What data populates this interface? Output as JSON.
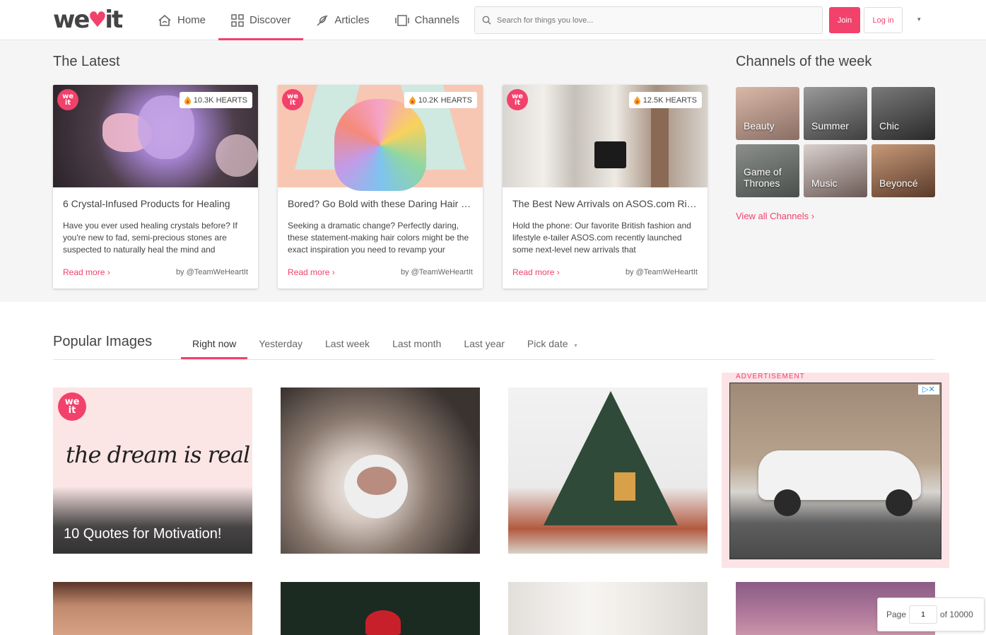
{
  "header": {
    "nav": [
      {
        "label": "Home",
        "icon": "home-icon"
      },
      {
        "label": "Discover",
        "icon": "grid-icon"
      },
      {
        "label": "Articles",
        "icon": "feather-icon"
      },
      {
        "label": "Channels",
        "icon": "channels-icon"
      }
    ],
    "search_placeholder": "Search for things you love...",
    "join_label": "Join",
    "login_label": "Log in",
    "menu_caret": "▾"
  },
  "latest": {
    "title": "The Latest",
    "cards": [
      {
        "hearts": "10.3K HEARTS",
        "title": "6 Crystal-Infused Products for Healing",
        "text": "Have you ever used healing crystals before? If you're new to fad, semi-precious stones are suspected to naturally heal the mind and",
        "read_more": "Read more ›",
        "author": "by @TeamWeHeartIt"
      },
      {
        "hearts": "10.2K HEARTS",
        "title": "Bored? Go Bold with these Daring Hair Colors",
        "text": "Seeking a dramatic change? Perfectly daring, these statement-making hair colors might be the exact inspiration you need to revamp your",
        "read_more": "Read more ›",
        "author": "by @TeamWeHeartIt"
      },
      {
        "hearts": "12.5K HEARTS",
        "title": "The Best New Arrivals on ASOS.com Right Now",
        "text": "Hold the phone: Our favorite British fashion and lifestyle e-tailer ASOS.com recently launched some next-level new arrivals that",
        "read_more": "Read more ›",
        "author": "by @TeamWeHeartIt"
      }
    ]
  },
  "channels": {
    "title": "Channels of the week",
    "items": [
      "Beauty",
      "Summer",
      "Chic",
      "Game of Thrones",
      "Music",
      "Beyoncé"
    ],
    "view_all": "View all Channels ›"
  },
  "popular": {
    "title": "Popular Images",
    "tabs": [
      "Right now",
      "Yesterday",
      "Last week",
      "Last month",
      "Last year",
      "Pick date"
    ],
    "tile_caption": "10 Quotes for Motivation!",
    "quote_text": "the dream is real"
  },
  "ad": {
    "label": "ADVERTISEMENT"
  },
  "pager": {
    "page_label": "Page",
    "page_value": "1",
    "of_label": "of 10000"
  },
  "colors": {
    "accent": "#f2416b",
    "latest_bg": "#f5f5f5"
  }
}
